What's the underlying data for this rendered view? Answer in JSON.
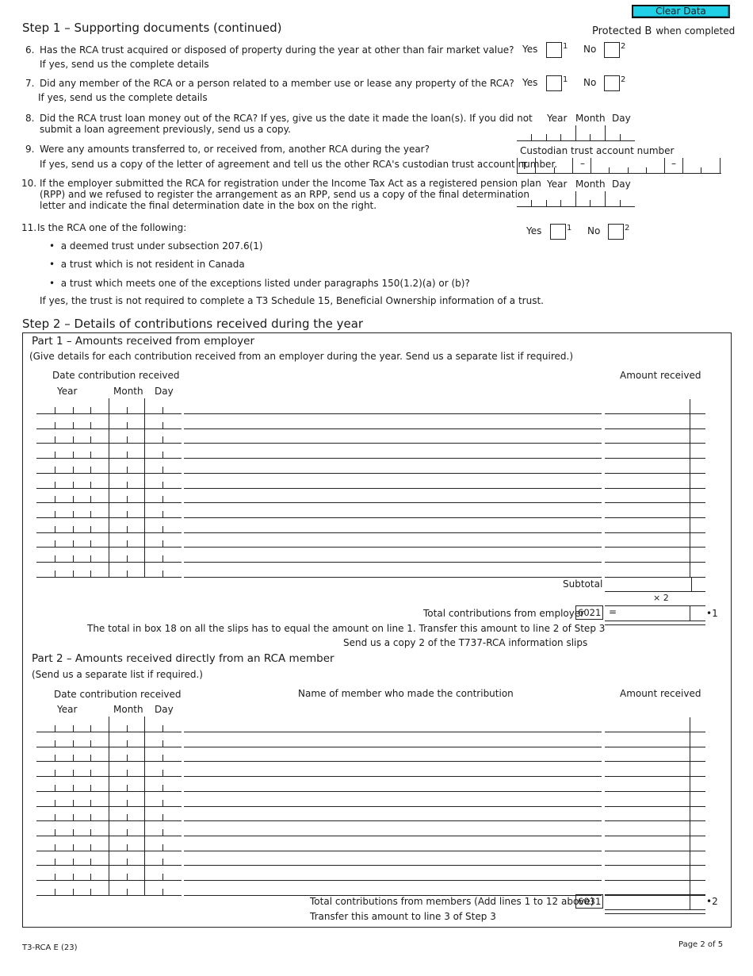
{
  "header": {
    "clear_button": "Clear Data",
    "protected_main": "Protected B",
    "protected_suffix": "when completed"
  },
  "step1": {
    "title": "Step 1 – Supporting documents (continued)",
    "yes_label": "Yes",
    "no_label": "No",
    "yes_num": "1",
    "no_num": "2",
    "q6": {
      "num": "6.",
      "text": "Has the RCA trust acquired or disposed of property during the year at other than fair market value?",
      "sub": "If yes, send us the complete details"
    },
    "q7": {
      "num": "7.",
      "text": "Did any member of the RCA or a person related to a member use or lease any property of the RCA?",
      "sub": "If yes, send us the complete details"
    },
    "q8": {
      "num": "8.",
      "line1": "Did the RCA trust loan money out of the RCA? If yes, give us the date it made the loan(s). If you did not",
      "line2": "submit a loan agreement previously, send us a copy."
    },
    "q9": {
      "num": "9.",
      "text": "Were any amounts transferred to, or received from, another RCA during the year?",
      "sub": "If yes, send us a copy of the letter of agreement and tell us the other RCA's custodian trust account number."
    },
    "q10": {
      "num": "10.",
      "line1": "If the employer submitted the RCA for registration under the Income Tax Act as a registered pension plan",
      "line2": "(RPP) and we refused to register the arrangement as an RPP, send us a copy of the final determination",
      "line3": "letter and indicate the final determination date in the box on the right."
    },
    "q11": {
      "num": "11.",
      "text": "Is the RCA one of the following:",
      "bullets": [
        "a deemed trust under subsection 207.6(1)",
        "a trust which is not resident in Canada",
        "a trust which meets one of the exceptions listed under paragraphs 150(1.2)(a) or (b)?"
      ],
      "sub": "If yes, the trust is not required to complete a T3 Schedule 15, Beneficial Ownership information of a trust."
    },
    "date_labels": {
      "year": "Year",
      "month": "Month",
      "day": "Day"
    },
    "custodian_label": "Custodian trust account number",
    "custodian_prefix": "T",
    "dash": "–"
  },
  "step2": {
    "title": "Step 2 – Details of contributions received during the year",
    "part1": {
      "title": "Part 1 – Amounts received from employer",
      "note": "(Give details for each contribution received from an employer during the year. Send us a separate list if required.)",
      "date_header": "Date contribution received",
      "amount_header": "Amount received",
      "row_count": 12,
      "subtotal_label": "Subtotal",
      "multiplier": "×  2",
      "total_label": "Total contributions from employer",
      "total_code": "6021",
      "equals": "=",
      "line_ref": "•1",
      "note1": "The total in box 18 on all the slips has to equal the amount on line 1. Transfer this amount to line 2 of Step 3",
      "note2": "Send us a copy 2 of the T737-RCA information slips"
    },
    "part2": {
      "title": "Part 2 – Amounts received directly from an RCA member",
      "note": "(Send us a separate list if required.)",
      "date_header": "Date contribution received",
      "name_header": "Name of member who made the contribution",
      "amount_header": "Amount received",
      "row_count": 12,
      "total_label": "Total contributions from members (Add lines 1 to 12 above)",
      "total_code": "6031",
      "line_ref": "•2",
      "transfer_note": "Transfer this amount to line 3 of Step 3"
    }
  },
  "footer": {
    "form_id": "T3-RCA E (23)",
    "page": "Page 2 of 5"
  }
}
